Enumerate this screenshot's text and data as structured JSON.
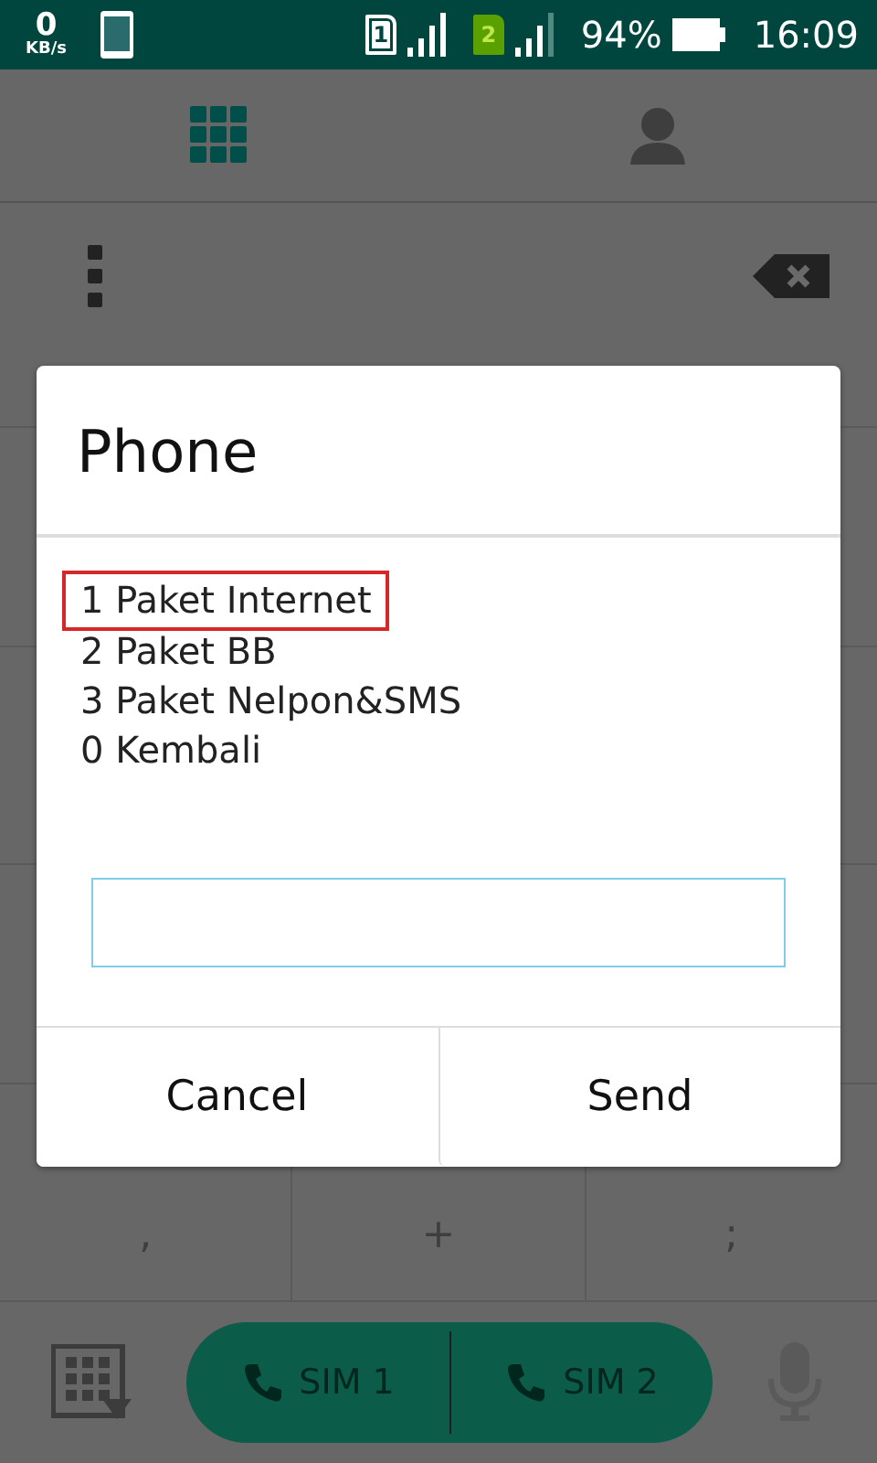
{
  "status_bar": {
    "speed": "0",
    "speed_unit": "KB/s",
    "sim_slots": [
      {
        "label": "1"
      },
      {
        "label": "2"
      }
    ],
    "battery": "94%",
    "time": "16:09"
  },
  "tabs": [
    {
      "kind": "dialpad",
      "selected": true
    },
    {
      "kind": "contacts",
      "selected": false
    }
  ],
  "dialog": {
    "title": "Phone",
    "options": [
      {
        "text": "1 Paket Internet",
        "highlighted": true
      },
      {
        "text": "2 Paket BB",
        "highlighted": false
      },
      {
        "text": "3 Paket Nelpon&SMS",
        "highlighted": false
      },
      {
        "text": "0 Kembali",
        "highlighted": false
      }
    ],
    "buttons": [
      "Cancel",
      "Send"
    ]
  },
  "keypad_row": [
    {
      "sub": ","
    },
    {
      "sub": "+"
    },
    {
      "sub": ";"
    }
  ],
  "call_buttons": [
    {
      "label": "SIM 1"
    },
    {
      "label": "SIM 2"
    }
  ]
}
